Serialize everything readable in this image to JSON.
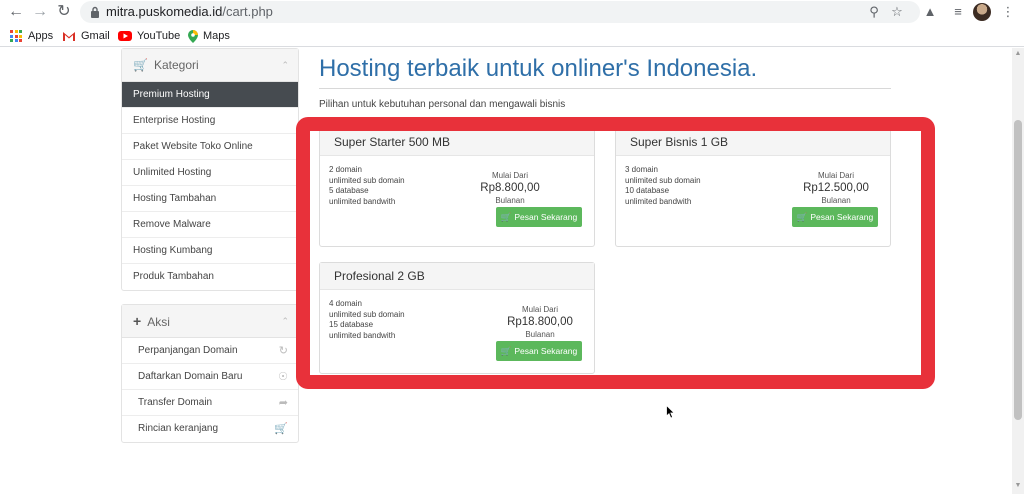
{
  "browser": {
    "url_host": "mitra.puskomedia.id",
    "url_path": "/cart.php",
    "bookmarks": [
      {
        "label": "Apps",
        "icon": "apps-grid-icon"
      },
      {
        "label": "Gmail",
        "icon": "gmail-icon"
      },
      {
        "label": "YouTube",
        "icon": "youtube-icon"
      },
      {
        "label": "Maps",
        "icon": "maps-icon"
      }
    ]
  },
  "sidebar": {
    "kategori_title": "Kategori",
    "kategori_items": [
      {
        "label": "Premium Hosting"
      },
      {
        "label": "Enterprise Hosting"
      },
      {
        "label": "Paket Website Toko Online"
      },
      {
        "label": "Unlimited Hosting"
      },
      {
        "label": "Hosting Tambahan"
      },
      {
        "label": "Remove Malware"
      },
      {
        "label": "Hosting Kumbang"
      },
      {
        "label": "Produk Tambahan"
      }
    ],
    "aksi_title": "Aksi",
    "aksi_items": [
      {
        "label": "Perpanjangan Domain",
        "icon": "refresh-icon"
      },
      {
        "label": "Daftarkan Domain Baru",
        "icon": "globe-icon"
      },
      {
        "label": "Transfer Domain",
        "icon": "share-icon"
      },
      {
        "label": "Rincian keranjang",
        "icon": "cart-icon"
      }
    ]
  },
  "main": {
    "title": "Hosting terbaik untuk onliner's Indonesia.",
    "subtitle": "Pilihan untuk kebutuhan personal dan mengawali bisnis"
  },
  "products": [
    {
      "name": "Super Starter 500 MB",
      "features": [
        "2 domain",
        "unlimited sub domain",
        "5 database",
        "unlimited bandwith"
      ],
      "from_label": "Mulai Dari",
      "price": "Rp8.800,00",
      "cycle": "Bulanan",
      "button": "Pesan Sekarang"
    },
    {
      "name": "Super Bisnis 1 GB",
      "features": [
        "3 domain",
        "unlimited sub domain",
        "10 database",
        "unlimited bandwith"
      ],
      "from_label": "Mulai Dari",
      "price": "Rp12.500,00",
      "cycle": "Bulanan",
      "button": "Pesan Sekarang"
    },
    {
      "name": "Profesional 2 GB",
      "features": [
        "4 domain",
        "unlimited sub domain",
        "15 database",
        "unlimited bandwith"
      ],
      "from_label": "Mulai Dari",
      "price": "Rp18.800,00",
      "cycle": "Bulanan",
      "button": "Pesan Sekarang"
    }
  ],
  "colors": {
    "accent": "#2f6fa8",
    "button": "#5cb85c",
    "active_menu": "#464b50",
    "highlight": "#e8313a"
  }
}
